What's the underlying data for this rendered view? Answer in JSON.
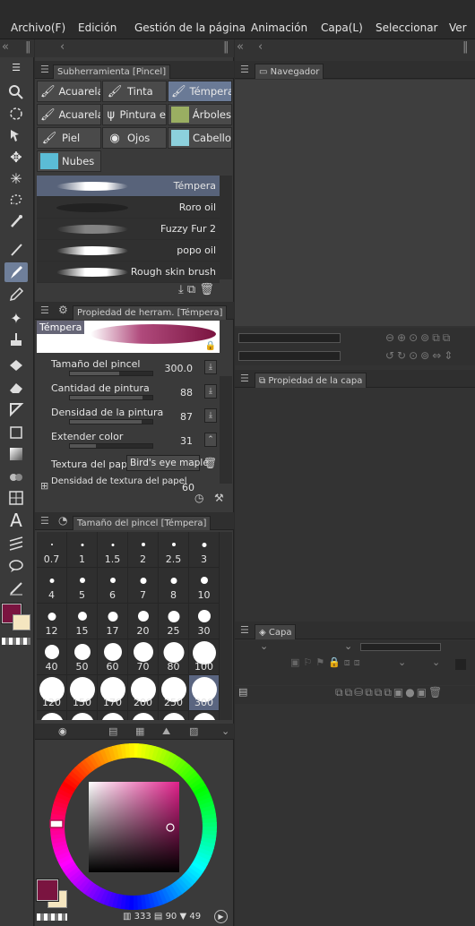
{
  "menu": [
    "Archivo(F)",
    "Edición",
    "Gestión de la página",
    "Animación",
    "Capa(L)",
    "Seleccionar",
    "Ver"
  ],
  "strip_glyphs": {
    "collapse": "«",
    "left": "‹",
    "sep": "‖"
  },
  "colors": {
    "main": "#7a1440",
    "sub": "#f5e6c0",
    "accent": "#6a7a96"
  },
  "subtool_panel": {
    "title": "Subherramienta [Pincel]",
    "buttons": [
      {
        "label": "Acuarela",
        "icon": "brush-icon"
      },
      {
        "label": "Tinta",
        "icon": "brush-icon"
      },
      {
        "label": "Témpera",
        "icon": "brush-icon",
        "selected": true
      },
      {
        "label": "Acuarela",
        "icon": "brush-icon"
      },
      {
        "label": "Pintura e",
        "icon": "grass-icon"
      },
      {
        "label": "Árboles",
        "icon": "tree-icon"
      },
      {
        "label": "Piel",
        "icon": "brush-icon"
      },
      {
        "label": "Ojos",
        "icon": "eye-icon"
      },
      {
        "label": "Cabello",
        "icon": "hair-icon"
      },
      {
        "label": "Nubes",
        "icon": "cloud-icon"
      }
    ],
    "brushes": [
      {
        "name": "Témpera",
        "selected": true
      },
      {
        "name": "Roro oil"
      },
      {
        "name": "Fuzzy Fur 2"
      },
      {
        "name": "popo oil"
      },
      {
        "name": "Rough skin brush"
      }
    ]
  },
  "tool_property": {
    "title": "Propiedad de herram. [Témpera]",
    "preview_label": "Témpera",
    "props": [
      {
        "label": "Tamaño del pincel",
        "value": "300.0",
        "fill": 0.6
      },
      {
        "label": "Cantidad de pintura",
        "value": "88",
        "fill": 0.88
      },
      {
        "label": "Densidad de la pintura",
        "value": "87",
        "fill": 0.87
      },
      {
        "label": "Extender color",
        "value": "31",
        "fill": 0.31
      }
    ],
    "texture_label": "Textura del papel",
    "texture_value": "Bird's eye maple",
    "texture_density_label": "Densidad de textura del papel",
    "texture_density_value": "60"
  },
  "brush_size": {
    "title": "Tamaño del pincel [Témpera]",
    "sizes": [
      "0.7",
      "1",
      "1.5",
      "2",
      "2.5",
      "3",
      "4",
      "5",
      "6",
      "7",
      "8",
      "10",
      "12",
      "15",
      "17",
      "20",
      "25",
      "30",
      "40",
      "50",
      "60",
      "70",
      "80",
      "100",
      "120",
      "150",
      "170",
      "200",
      "250",
      "300"
    ],
    "selected": "300"
  },
  "color_wheel": {
    "stats": [
      "333",
      "90",
      "49"
    ]
  },
  "navigator": {
    "title": "Navegador"
  },
  "layer_property": {
    "title": "Propiedad de la capa"
  },
  "layer": {
    "title": "Capa"
  }
}
